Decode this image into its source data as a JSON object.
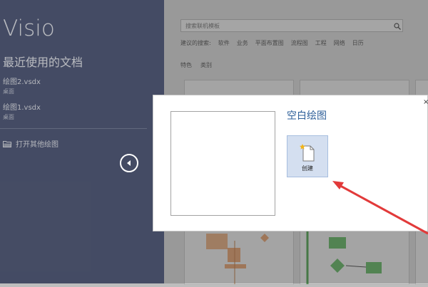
{
  "app": {
    "title": "Visio"
  },
  "recent": {
    "heading": "最近使用的文档",
    "items": [
      {
        "name": "绘图2.vsdx",
        "path": "桌面"
      },
      {
        "name": "绘图1.vsdx",
        "path": "桌面"
      }
    ],
    "open_other": "打开其他绘图"
  },
  "search": {
    "placeholder": "搜索联机模板"
  },
  "suggested": {
    "label": "建议的搜索:",
    "items": [
      "软件",
      "业务",
      "平面布置图",
      "流程图",
      "工程",
      "网络",
      "日历"
    ]
  },
  "tabs": [
    "特色",
    "类别"
  ],
  "modal": {
    "title": "空白绘图",
    "create_label": "创建",
    "close": "×"
  },
  "colors": {
    "accent": "#2e5f99",
    "arrow": "#e23a3a",
    "left_pane": "#586180"
  }
}
